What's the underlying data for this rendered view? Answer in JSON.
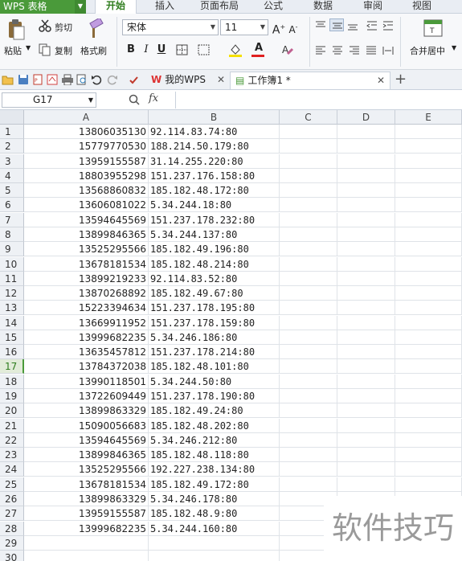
{
  "app": {
    "title": "WPS 表格"
  },
  "menu_tabs": [
    "开始",
    "插入",
    "页面布局",
    "公式",
    "数据",
    "审阅",
    "视图"
  ],
  "ribbon": {
    "paste": "粘贴",
    "cut": "剪切",
    "copy": "复制",
    "format_painter": "格式刷",
    "font_name": "宋体",
    "font_size": "11",
    "merge_center": "合并居中"
  },
  "doc_tabs": {
    "home": "我的WPS",
    "workbook": "工作簿1 *"
  },
  "name_box": "G17",
  "fx_label": "fx",
  "columns": [
    "A",
    "B",
    "C",
    "D",
    "E"
  ],
  "selected_row": 17,
  "rows": [
    {
      "n": "1",
      "a": "13806035130",
      "b": "92.114.83.74:80"
    },
    {
      "n": "2",
      "a": "15779770530",
      "b": "188.214.50.179:80"
    },
    {
      "n": "3",
      "a": "13959155587",
      "b": "31.14.255.220:80"
    },
    {
      "n": "4",
      "a": "18803955298",
      "b": "151.237.176.158:80"
    },
    {
      "n": "5",
      "a": "13568860832",
      "b": "185.182.48.172:80"
    },
    {
      "n": "6",
      "a": "13606081022",
      "b": "5.34.244.18:80"
    },
    {
      "n": "7",
      "a": "13594645569",
      "b": "151.237.178.232:80"
    },
    {
      "n": "8",
      "a": "13899846365",
      "b": "5.34.244.137:80"
    },
    {
      "n": "9",
      "a": "13525295566",
      "b": "185.182.49.196:80"
    },
    {
      "n": "10",
      "a": "13678181534",
      "b": "185.182.48.214:80"
    },
    {
      "n": "11",
      "a": "13899219233",
      "b": "92.114.83.52:80"
    },
    {
      "n": "12",
      "a": "13870268892",
      "b": "185.182.49.67:80"
    },
    {
      "n": "13",
      "a": "15223394634",
      "b": "151.237.178.195:80"
    },
    {
      "n": "14",
      "a": "13669911952",
      "b": "151.237.178.159:80"
    },
    {
      "n": "15",
      "a": "13999682235",
      "b": "5.34.246.186:80"
    },
    {
      "n": "16",
      "a": "13635457812",
      "b": "151.237.178.214:80"
    },
    {
      "n": "17",
      "a": "13784372038",
      "b": "185.182.48.101:80"
    },
    {
      "n": "18",
      "a": "13990118501",
      "b": "5.34.244.50:80"
    },
    {
      "n": "19",
      "a": "13722609449",
      "b": "151.237.178.190:80"
    },
    {
      "n": "20",
      "a": "13899863329",
      "b": "185.182.49.24:80"
    },
    {
      "n": "21",
      "a": "15090056683",
      "b": "185.182.48.202:80"
    },
    {
      "n": "22",
      "a": "13594645569",
      "b": "5.34.246.212:80"
    },
    {
      "n": "23",
      "a": "13899846365",
      "b": "185.182.48.118:80"
    },
    {
      "n": "24",
      "a": "13525295566",
      "b": "192.227.238.134:80"
    },
    {
      "n": "25",
      "a": "13678181534",
      "b": "185.182.49.172:80"
    },
    {
      "n": "26",
      "a": "13899863329",
      "b": "5.34.246.178:80"
    },
    {
      "n": "27",
      "a": "13959155587",
      "b": "185.182.48.9:80"
    },
    {
      "n": "28",
      "a": "13999682235",
      "b": "5.34.244.160:80"
    },
    {
      "n": "29",
      "a": "",
      "b": ""
    },
    {
      "n": "30",
      "a": "",
      "b": ""
    }
  ],
  "watermark": "软件技巧",
  "colors": {
    "accent": "#4a9a3a",
    "tab_active_text": "#2f7d1e"
  }
}
